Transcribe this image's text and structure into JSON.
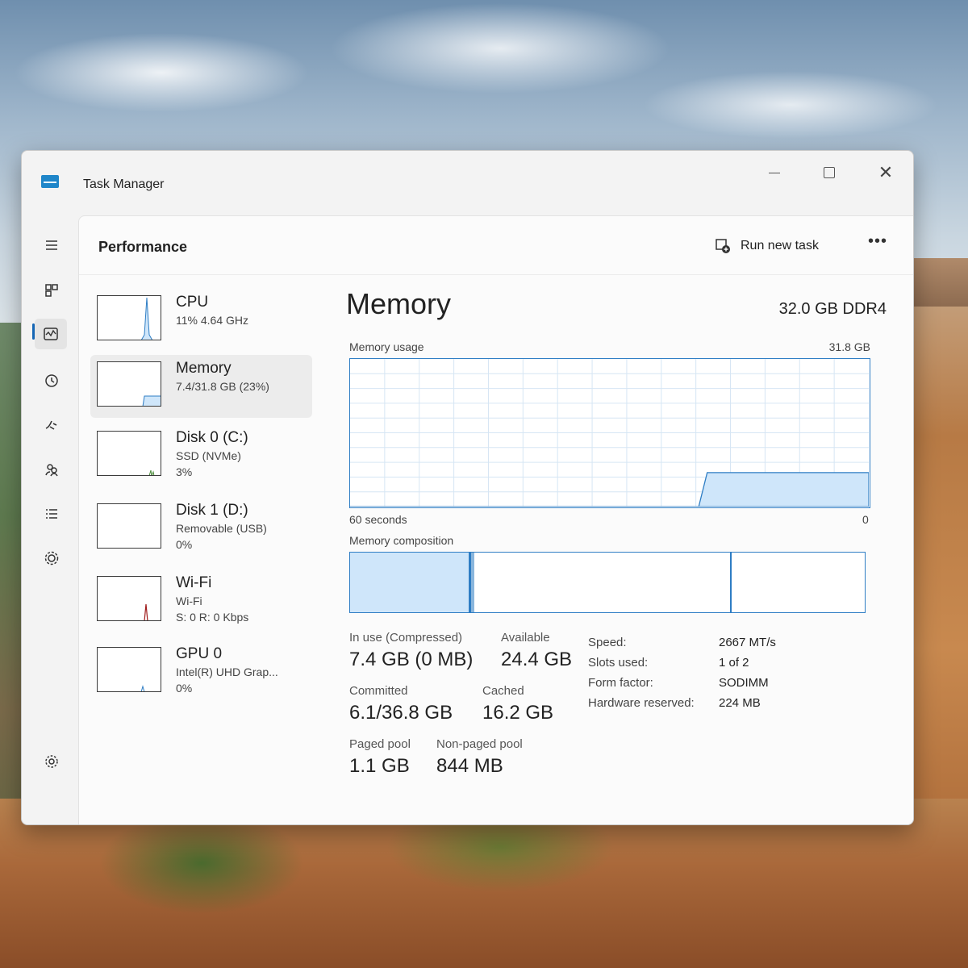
{
  "window": {
    "title": "Task Manager"
  },
  "header": {
    "page_title": "Performance",
    "run_new_task_label": "Run new task",
    "more_label": "•••"
  },
  "devices": [
    {
      "name": "CPU",
      "sub": "11% 4.64 GHz",
      "sub2": "",
      "usage_percent": 11
    },
    {
      "name": "Memory",
      "sub": "7.4/31.8 GB (23%)",
      "sub2": "",
      "usage_percent": 23
    },
    {
      "name": "Disk 0 (C:)",
      "sub": "SSD (NVMe)",
      "sub2": "3%",
      "usage_percent": 3
    },
    {
      "name": "Disk 1 (D:)",
      "sub": "Removable (USB)",
      "sub2": "0%",
      "usage_percent": 0
    },
    {
      "name": "Wi-Fi",
      "sub": "Wi-Fi",
      "sub2": "S: 0 R: 0 Kbps",
      "usage_percent": 0
    },
    {
      "name": "GPU 0",
      "sub": "Intel(R) UHD Grap...",
      "sub2": "0%",
      "usage_percent": 0
    }
  ],
  "memory": {
    "title": "Memory",
    "spec": "32.0 GB DDR4",
    "usage_label": "Memory usage",
    "usage_max": "31.8 GB",
    "time_label": "60 seconds",
    "time_zero": "0",
    "composition_label": "Memory composition",
    "stats": {
      "in_use_label": "In use (Compressed)",
      "in_use_value": "7.4 GB (0 MB)",
      "available_label": "Available",
      "available_value": "24.4 GB",
      "committed_label": "Committed",
      "committed_value": "6.1/36.8 GB",
      "cached_label": "Cached",
      "cached_value": "16.2 GB",
      "paged_label": "Paged pool",
      "paged_value": "1.1 GB",
      "nonpaged_label": "Non-paged pool",
      "nonpaged_value": "844 MB"
    },
    "specs": [
      {
        "key": "Speed:",
        "value": "2667 MT/s"
      },
      {
        "key": "Slots used:",
        "value": "1 of 2"
      },
      {
        "key": "Form factor:",
        "value": "SODIMM"
      },
      {
        "key": "Hardware reserved:",
        "value": "224 MB"
      }
    ],
    "composition": {
      "in_use_fraction": 0.23,
      "standby_boundary_fraction": 0.74
    },
    "usage_history_percent": [
      0,
      0,
      0,
      0,
      0,
      0,
      0,
      0,
      0,
      0,
      0,
      0,
      0,
      0,
      0,
      0,
      0,
      0,
      0,
      0,
      0,
      0,
      0,
      0,
      0,
      0,
      0,
      0,
      0,
      0,
      0,
      0,
      0,
      0,
      0,
      0,
      0,
      0,
      0,
      0,
      0,
      0,
      23,
      23,
      23,
      23,
      23,
      23,
      23,
      23,
      23,
      23,
      23,
      23,
      23,
      23,
      23,
      23,
      23,
      23,
      23,
      23
    ]
  },
  "colors": {
    "accent": "#2e7dc4",
    "fill": "#cfe6fa",
    "active_indicator": "#1566b5"
  }
}
